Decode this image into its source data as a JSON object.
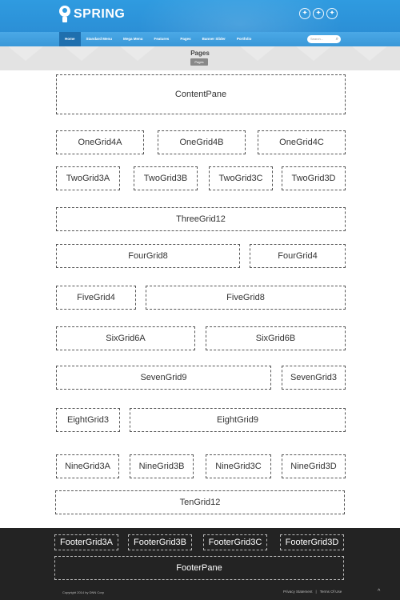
{
  "header": {
    "logo_text": "SPRING",
    "social": [
      "✦",
      "✦",
      "✦"
    ]
  },
  "nav": {
    "items": [
      "Home",
      "Standard Menu",
      "Mega Menu",
      "Features",
      "Pages",
      "Banner Slider",
      "Portfolio"
    ],
    "search_placeholder": "Search..."
  },
  "page": {
    "title": "Pages",
    "breadcrumb": "Pages"
  },
  "panes": {
    "content": "ContentPane",
    "one": [
      "OneGrid4A",
      "OneGrid4B",
      "OneGrid4C"
    ],
    "two": [
      "TwoGrid3A",
      "TwoGrid3B",
      "TwoGrid3C",
      "TwoGrid3D"
    ],
    "three": "ThreeGrid12",
    "four": [
      "FourGrid8",
      "FourGrid4"
    ],
    "five": [
      "FiveGrid4",
      "FiveGrid8"
    ],
    "six": [
      "SixGrid6A",
      "SixGrid6B"
    ],
    "seven": [
      "SevenGrid9",
      "SevenGrid3"
    ],
    "eight": [
      "EightGrid3",
      "EightGrid9"
    ],
    "nine": [
      "NineGrid3A",
      "NineGrid3B",
      "NineGrid3C",
      "NineGrid3D"
    ],
    "ten": "TenGrid12"
  },
  "footer": {
    "grids": [
      "FooterGrid3A",
      "FooterGrid3B",
      "FooterGrid3C",
      "FooterGrid3D"
    ],
    "pane": "FooterPane",
    "copyright": "Copyright 2014 by DNN Corp",
    "privacy": "Privacy Statement",
    "separator": "|",
    "terms": "Terms Of Use",
    "top_icon": "^"
  }
}
